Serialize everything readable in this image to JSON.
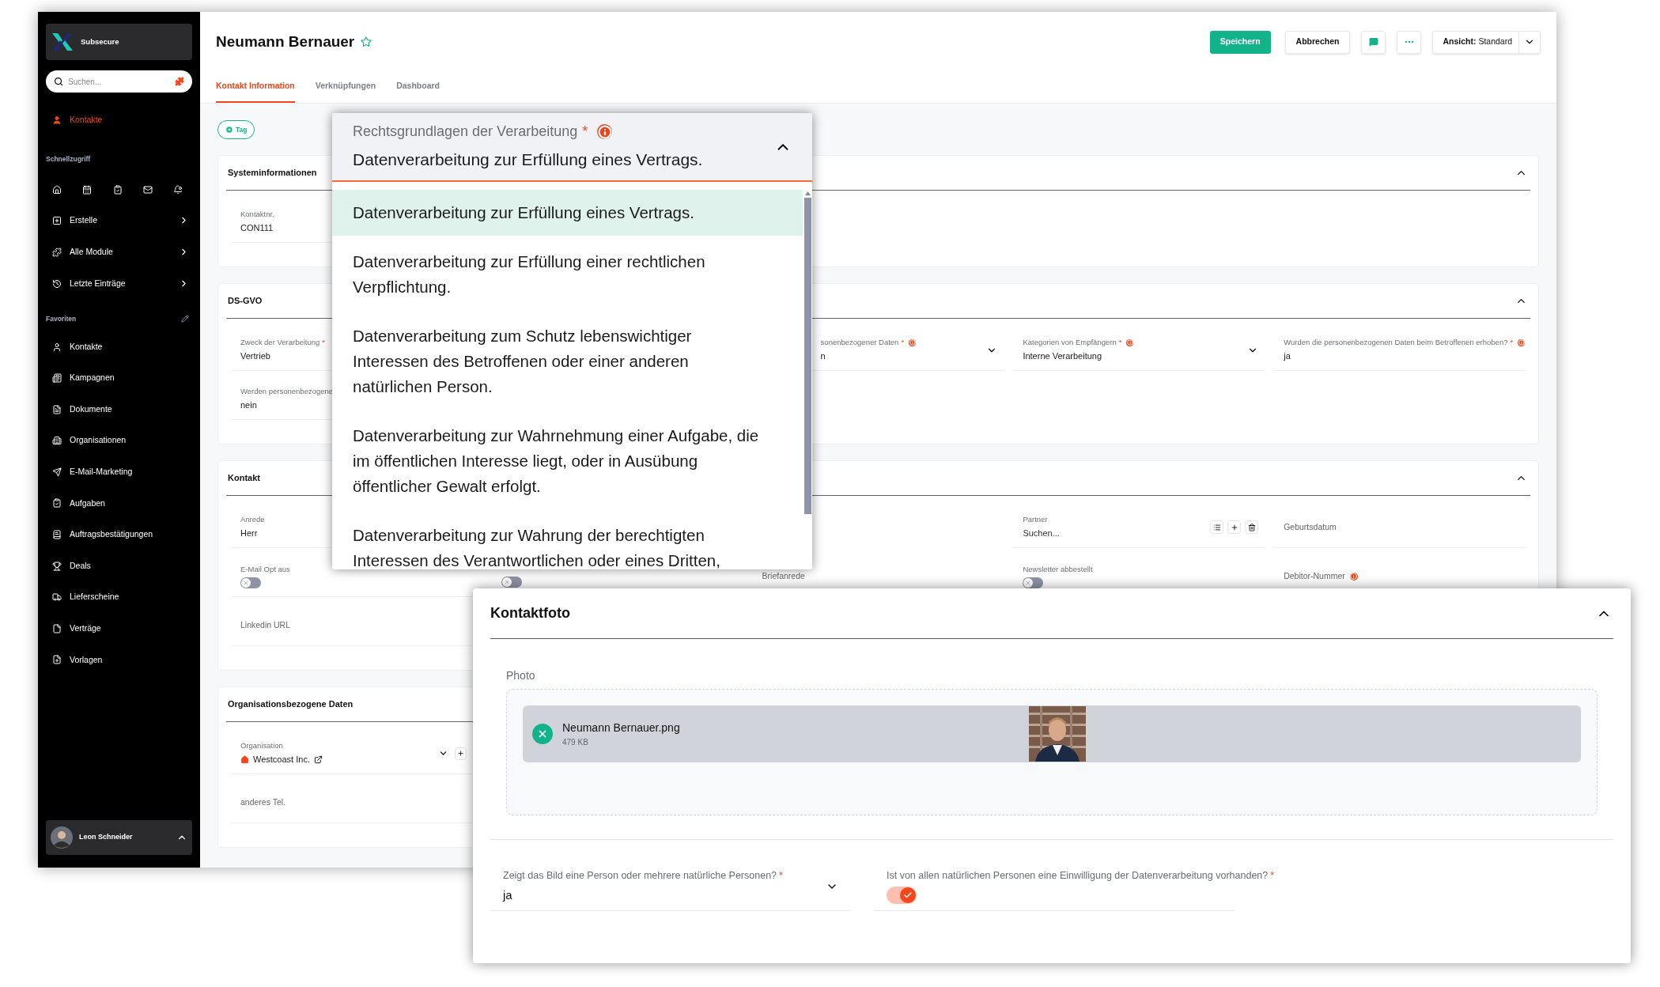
{
  "sidebar": {
    "brand": "Subsecure",
    "search": {
      "placeholder": "Suchen..."
    },
    "active_item": {
      "label": "Kontakte",
      "selected": true
    },
    "quick_access": {
      "title": "Schnellzugriff",
      "menus": [
        {
          "label": "Erstelle"
        },
        {
          "label": "Alle Module"
        },
        {
          "label": "Letzte Einträge"
        }
      ]
    },
    "favorites": {
      "title": "Favoriten",
      "items": [
        {
          "label": "Kontakte"
        },
        {
          "label": "Kampagnen"
        },
        {
          "label": "Dokumente"
        },
        {
          "label": "Organisationen"
        },
        {
          "label": "E-Mail-Marketing"
        },
        {
          "label": "Aufgaben"
        },
        {
          "label": "Auftragsbestätigungen"
        },
        {
          "label": "Deals"
        },
        {
          "label": "Lieferscheine"
        },
        {
          "label": "Verträge"
        },
        {
          "label": "Vorlagen"
        }
      ]
    },
    "user": {
      "name": "Leon Schneider"
    }
  },
  "header": {
    "title": "Neumann Bernauer",
    "starred": false,
    "save": "Speichern",
    "cancel": "Abbrechen",
    "view_label": "Ansicht:",
    "view_value": "Standard"
  },
  "tabs": [
    {
      "label": "Kontakt Information",
      "selected": true
    },
    {
      "label": "Verknüpfungen",
      "selected": false
    },
    {
      "label": "Dashboard",
      "selected": false
    }
  ],
  "tag_button": "Tag",
  "sections": [
    {
      "title": "Systeminformationen",
      "expanded": true,
      "rows": [
        [
          {
            "kind": "text",
            "label": "Kontaktnr.",
            "value": "CON111"
          }
        ]
      ]
    },
    {
      "title": "DS-GVO",
      "expanded": true,
      "rows": [
        [
          {
            "kind": "text",
            "label": "Zweck der Verarbeitung",
            "required_mark": "*",
            "value": "Vertrieb"
          },
          "",
          {
            "kind": "select",
            "label": "sonenbezogener Daten",
            "required_mark": "*",
            "info": true,
            "value": "n"
          },
          {
            "kind": "select",
            "label": "Kategorien von Empfängern",
            "required_mark": "*",
            "info": true,
            "value": "Interne Verarbeitung"
          },
          {
            "kind": "select",
            "label": "Wurden die personenbezogenen Daten beim Betroffenen erhoben?",
            "required_mark": "*",
            "info": true,
            "value": "ja"
          }
        ],
        [
          {
            "kind": "text",
            "label": "Werden personenbezogene",
            "value": "nein"
          }
        ]
      ]
    },
    {
      "title": "Kontakt",
      "expanded": true,
      "rows": [
        [
          {
            "kind": "text",
            "label": "Anrede",
            "value": "Herr"
          },
          "",
          "",
          {
            "kind": "lookup",
            "label": "Partner",
            "value": "Suchen..."
          },
          {
            "kind": "placeholder",
            "label": "Geburtsdatum"
          }
        ],
        [
          {
            "kind": "toggle",
            "label": "E-Mail Opt aus",
            "on": false
          },
          {
            "kind": "toggle",
            "on": false
          },
          {
            "kind": "placeholder",
            "label": "Briefanrede"
          },
          {
            "kind": "toggle",
            "label": "Newsletter abbestellt",
            "on": false
          },
          {
            "kind": "placeholder",
            "label": "Debitor-Nummer",
            "info": true
          }
        ],
        [
          {
            "kind": "placeholder",
            "label": "Linkedin URL"
          }
        ]
      ]
    },
    {
      "title": "Organisationsbezogene Daten",
      "rows": [
        [
          {
            "kind": "org",
            "label": "Organisation",
            "value": "Westcoast Inc."
          }
        ],
        [
          {
            "kind": "placeholder",
            "label": "anderes Tel."
          }
        ]
      ]
    }
  ],
  "dropdown": {
    "label": "Rechtsgrundlagen der Verarbeitung",
    "required_mark": "*",
    "info": true,
    "value": "Datenverarbeitung zur Erfüllung eines Vertrags.",
    "options": [
      {
        "label": "Datenverarbeitung zur Erfüllung eines Vertrags.",
        "selected": true
      },
      {
        "label": "Datenverarbeitung zur Erfüllung einer rechtlichen Verpflichtung.",
        "selected": false
      },
      {
        "label": "Datenverarbeitung zum Schutz lebenswichtiger Interessen des Betroffenen oder einer anderen natürlichen Person.",
        "selected": false
      },
      {
        "label": "Datenverarbeitung zur Wahrnehmung einer Aufgabe, die im öffentlichen Interesse liegt, oder in Ausübung öffentlicher Gewalt erfolgt.",
        "selected": false
      },
      {
        "label": "Datenverarbeitung zur Wahrung der berechtigten Interessen des Verantwortlichen oder eines Dritten,",
        "selected": false
      }
    ]
  },
  "photo_panel": {
    "title": "Kontaktfoto",
    "photo_label": "Photo",
    "file": {
      "name": "Neumann Bernauer.png",
      "size": "479 KB"
    },
    "fields": [
      {
        "kind": "select",
        "label": "Zeigt das Bild eine Person oder mehrere natürliche Personen?",
        "required_mark": "*",
        "value": "ja"
      },
      {
        "kind": "toggle",
        "label": "Ist von allen natürlichen Personen eine Einwilligung der Datenverarbeitung vorhanden?",
        "required_mark": "*",
        "on": true
      }
    ]
  }
}
